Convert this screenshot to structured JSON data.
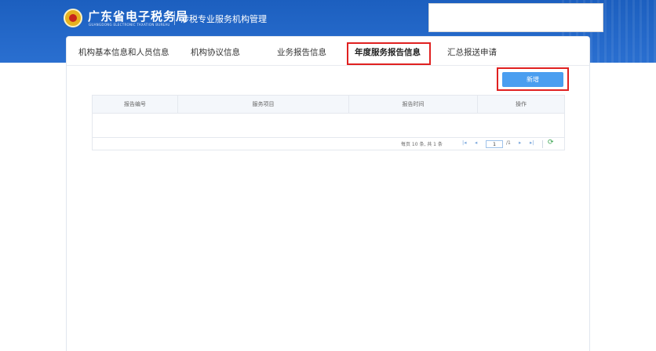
{
  "header": {
    "brand_main": "广东省电子税务局",
    "brand_sub": "GUANGDONG ELECTRONIC TAXATION BUREAU",
    "system_name": "涉税专业服务机构管理",
    "colors": {
      "banner": "#2a6fd0",
      "accent": "#2e73d9",
      "highlight": "#e02020"
    }
  },
  "tabs": [
    {
      "label": "机构基本信息和人员信息",
      "active": false
    },
    {
      "label": "机构协议信息",
      "active": false
    },
    {
      "label": "业务报告信息",
      "active": false
    },
    {
      "label": "年度服务报告信息",
      "active": true
    },
    {
      "label": "汇总报送申请",
      "active": false
    }
  ],
  "toolbar": {
    "add_label": "新增"
  },
  "table": {
    "columns": [
      "报告编号",
      "服务项目",
      "报告时间",
      "操作"
    ],
    "rows": []
  },
  "pager": {
    "summary": "每页 10 条, 共 1 条",
    "current_page": "1",
    "total_pages": "/1",
    "first_icon": "first-page-icon",
    "prev_icon": "prev-page-icon",
    "next_icon": "next-page-icon",
    "last_icon": "last-page-icon",
    "refresh_icon": "refresh-icon"
  }
}
